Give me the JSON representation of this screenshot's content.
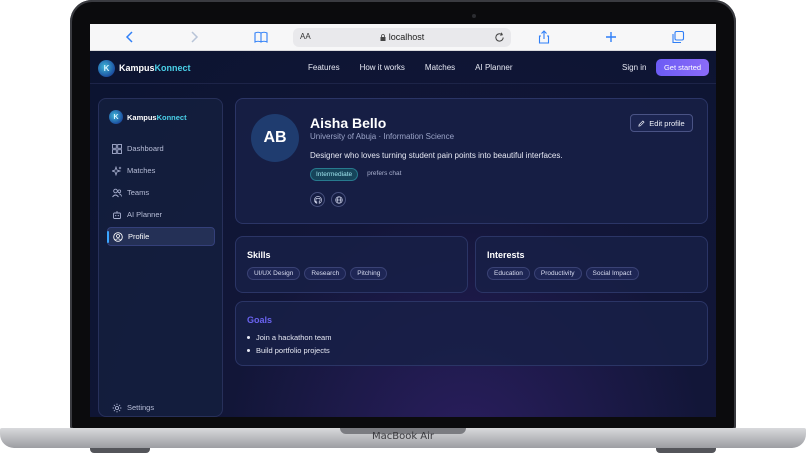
{
  "device": {
    "label": "MacBook Air"
  },
  "browser": {
    "text_size_label": "AA",
    "url": "localhost"
  },
  "app": {
    "brand": {
      "name_part1": "Kampus",
      "name_part2": "Konnect"
    },
    "nav": [
      "Features",
      "How it works",
      "Matches",
      "AI Planner"
    ],
    "sign_in": "Sign in",
    "get_started": "Get started",
    "accent_color": "#7c63f6"
  },
  "sidebar": {
    "brand": {
      "name_part1": "Kampus",
      "name_part2": "Konnect"
    },
    "items": [
      {
        "label": "Dashboard",
        "icon": "dashboard-icon"
      },
      {
        "label": "Matches",
        "icon": "sparkles-icon"
      },
      {
        "label": "Teams",
        "icon": "users-icon"
      },
      {
        "label": "AI Planner",
        "icon": "bot-icon"
      },
      {
        "label": "Profile",
        "icon": "user-circle-icon",
        "active": true
      }
    ],
    "settings": {
      "label": "Settings",
      "icon": "gear-icon"
    }
  },
  "profile": {
    "initials": "AB",
    "name": "Aisha Bello",
    "subtitle": "University of Abuja · Information Science",
    "bio": "Designer who loves turning student pain points into beautiful interfaces.",
    "level": "Intermediate",
    "preference": "prefers chat",
    "edit_label": "Edit profile",
    "links": [
      "github-icon",
      "globe-icon"
    ]
  },
  "skills": {
    "title": "Skills",
    "items": [
      "UI/UX Design",
      "Research",
      "Pitching"
    ]
  },
  "interests": {
    "title": "Interests",
    "items": [
      "Education",
      "Productivity",
      "Social Impact"
    ]
  },
  "goals": {
    "title": "Goals",
    "items": [
      "Join a hackathon team",
      "Build portfolio projects"
    ]
  }
}
